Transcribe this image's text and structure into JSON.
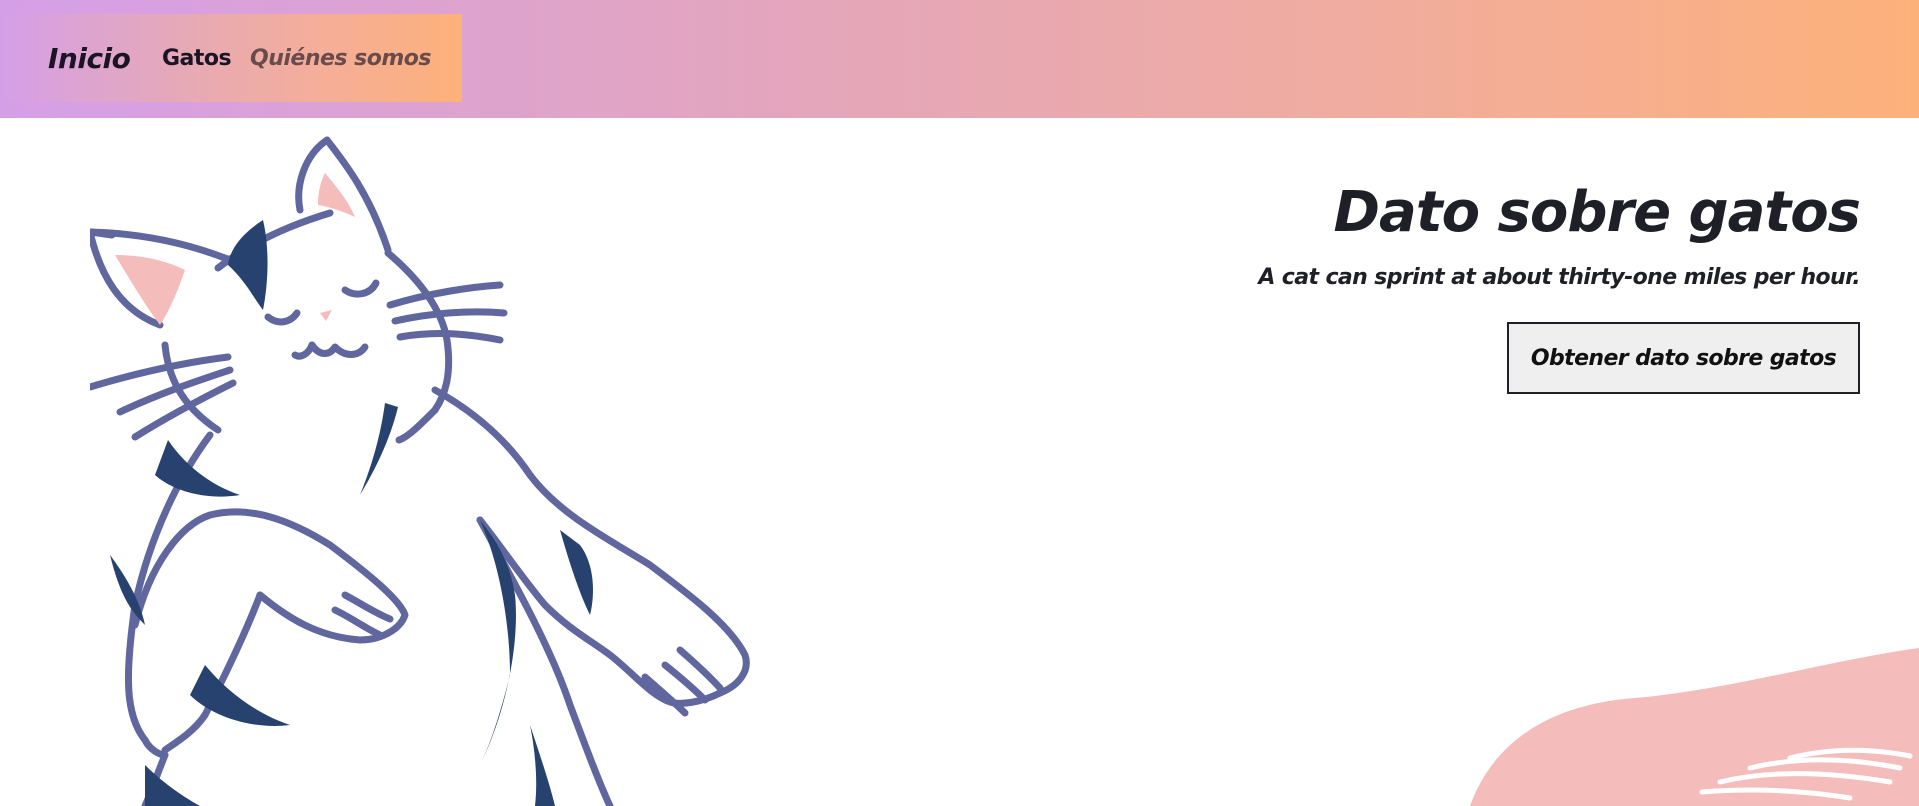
{
  "nav": {
    "home_label": "Inicio",
    "links": [
      {
        "label": "Gatos"
      },
      {
        "label": "Quiénes somos"
      }
    ]
  },
  "hero": {
    "title": "Dato sobre gatos",
    "fact": "A cat can sprint at about thirty-one miles per hour.",
    "button_label": "Obtener dato sobre gatos"
  },
  "illustration": {
    "subject": "cat-illustration",
    "colors": {
      "outline": "#5f679e",
      "stripes": "#27426e",
      "inner_ear": "#f5bcbc",
      "blob": "#f5bcbc"
    }
  },
  "colors": {
    "header_gradient_start": "#d59fe8",
    "header_gradient_end": "#fdb17a",
    "text_dark": "#1f1f27",
    "button_bg": "#efefef"
  }
}
